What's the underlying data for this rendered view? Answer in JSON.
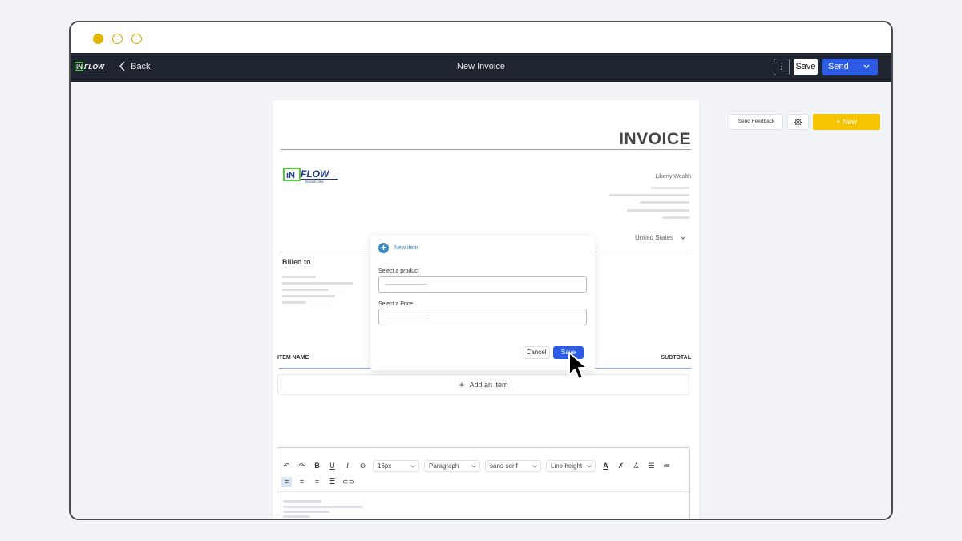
{
  "app": {
    "back_label": "Back",
    "title": "New Invoice",
    "more_label": "⋮",
    "save_label": "Save",
    "send_label": "Send",
    "brand_logo_text": "iN FLOW ENGINE CRM"
  },
  "side_actions": {
    "feedback_label": "Send Feedback",
    "new_label": "+ New"
  },
  "invoice": {
    "title": "INVOICE",
    "company_name": "Liberty Wealth",
    "country": "United States",
    "billed_to_label": "Billed to",
    "col_item_name": "ITEM NAME",
    "col_subtotal": "SUBTOTAL",
    "add_item_label": "Add an item"
  },
  "editor": {
    "font_size": "16px",
    "block_type": "Paragraph",
    "font_family": "sans-serif",
    "line_height": "Line height"
  },
  "modal": {
    "title": "New item",
    "product_label": "Select a product",
    "price_label": "Select a Price",
    "cancel_label": "Cancel",
    "save_label": "Save"
  },
  "colors": {
    "appbar": "#1e2530",
    "primary": "#2d5be3",
    "accent_yellow": "#f6c400",
    "traffic_light": "#e2b500"
  }
}
